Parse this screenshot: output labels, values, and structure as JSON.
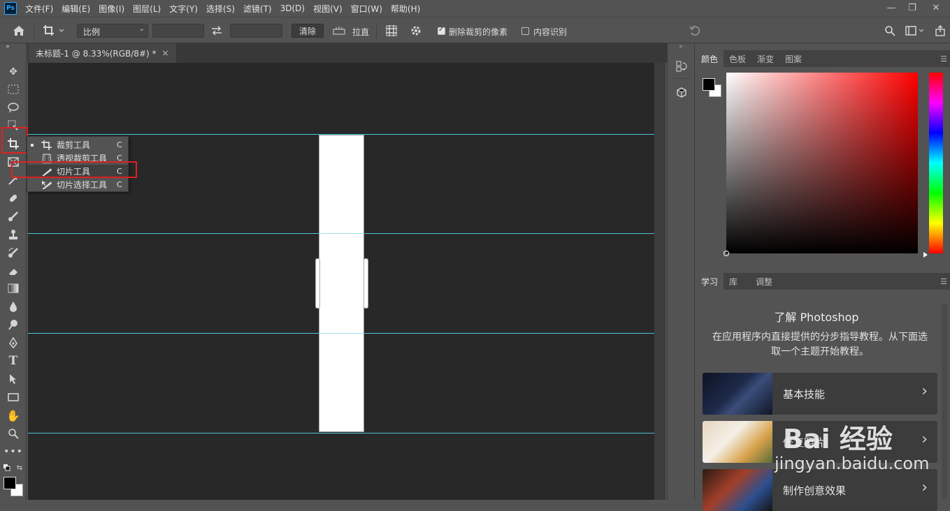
{
  "app": {
    "logo": "Ps"
  },
  "menu": [
    "文件(F)",
    "编辑(E)",
    "图像(I)",
    "图层(L)",
    "文字(Y)",
    "选择(S)",
    "滤镜(T)",
    "3D(D)",
    "视图(V)",
    "窗口(W)",
    "帮助(H)"
  ],
  "window_controls": {
    "minimize": "—",
    "restore": "❐",
    "close": "✕"
  },
  "options": {
    "ratio_select": "比例",
    "clear_button": "清除",
    "straighten_label": "拉直",
    "delete_cropped_label": "删除裁剪的像素",
    "delete_cropped_checked": true,
    "content_aware_label": "内容识别",
    "content_aware_checked": false
  },
  "document": {
    "tab_title": "未标题-1 @ 8.33%(RGB/8#) *",
    "close": "×"
  },
  "flyout": {
    "items": [
      {
        "label": "裁剪工具",
        "key": "C",
        "icon": "crop-icon",
        "active": true
      },
      {
        "label": "透视裁剪工具",
        "key": "C",
        "icon": "perspective-crop-icon",
        "active": false
      },
      {
        "label": "切片工具",
        "key": "C",
        "icon": "slice-icon",
        "active": false
      },
      {
        "label": "切片选择工具",
        "key": "C",
        "icon": "slice-select-icon",
        "active": false
      }
    ]
  },
  "color_panel": {
    "tabs": [
      "颜色",
      "色板",
      "渐变",
      "图案"
    ],
    "foreground": "#000000",
    "background": "#ffffff"
  },
  "learn_panel": {
    "tabs": [
      "学习",
      "库",
      "调整"
    ],
    "title": "了解 Photoshop",
    "description": "在应用程序内直接提供的分步指导教程。从下面选取一个主题开始教程。",
    "cards": [
      {
        "label": "基本技能"
      },
      {
        "label": "修复照片"
      },
      {
        "label": "制作创意效果"
      }
    ]
  },
  "watermark": {
    "brand": "Bai 经验",
    "url": "jingyan.baidu.com"
  }
}
